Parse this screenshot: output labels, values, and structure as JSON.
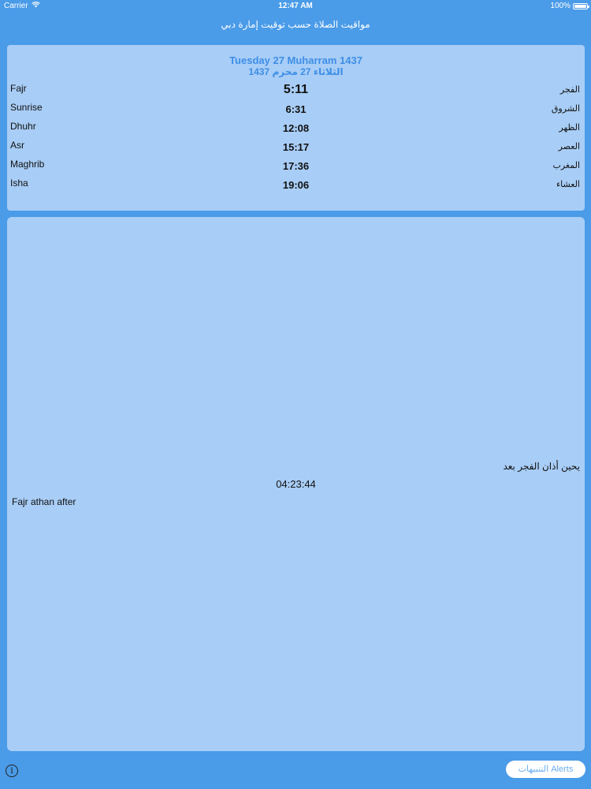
{
  "status_bar": {
    "carrier": "Carrier",
    "time": "12:47 AM",
    "battery": "100%"
  },
  "nav": {
    "title": "مواقيت الصلاة حسب توقيت إمارة دبي"
  },
  "date": {
    "gregorian_hijri_en": "Tuesday 27 Muharram 1437",
    "hijri_ar": "الثلاثاء 27 محرم 1437"
  },
  "prayers": [
    {
      "en": "Fajr",
      "time": "5:11",
      "ar": "الفجر"
    },
    {
      "en": "Sunrise",
      "time": "6:31",
      "ar": "الشروق"
    },
    {
      "en": "Dhuhr",
      "time": "12:08",
      "ar": "الظهر"
    },
    {
      "en": "Asr",
      "time": "15:17",
      "ar": "العصر"
    },
    {
      "en": "Maghrib",
      "time": "17:36",
      "ar": "المغرب"
    },
    {
      "en": "Isha",
      "time": "19:06",
      "ar": "العشاء"
    }
  ],
  "countdown": {
    "label_ar": "يحين أذان الفجر بعد",
    "time": "04:23:44",
    "label_en": "Fajr athan after"
  },
  "toolbar": {
    "info_glyph": "i",
    "alerts_label": "التنبيهات Alerts"
  },
  "colors": {
    "background": "#4a9be8",
    "card": "#a8cdf6",
    "date_text": "#3d8ee6"
  }
}
